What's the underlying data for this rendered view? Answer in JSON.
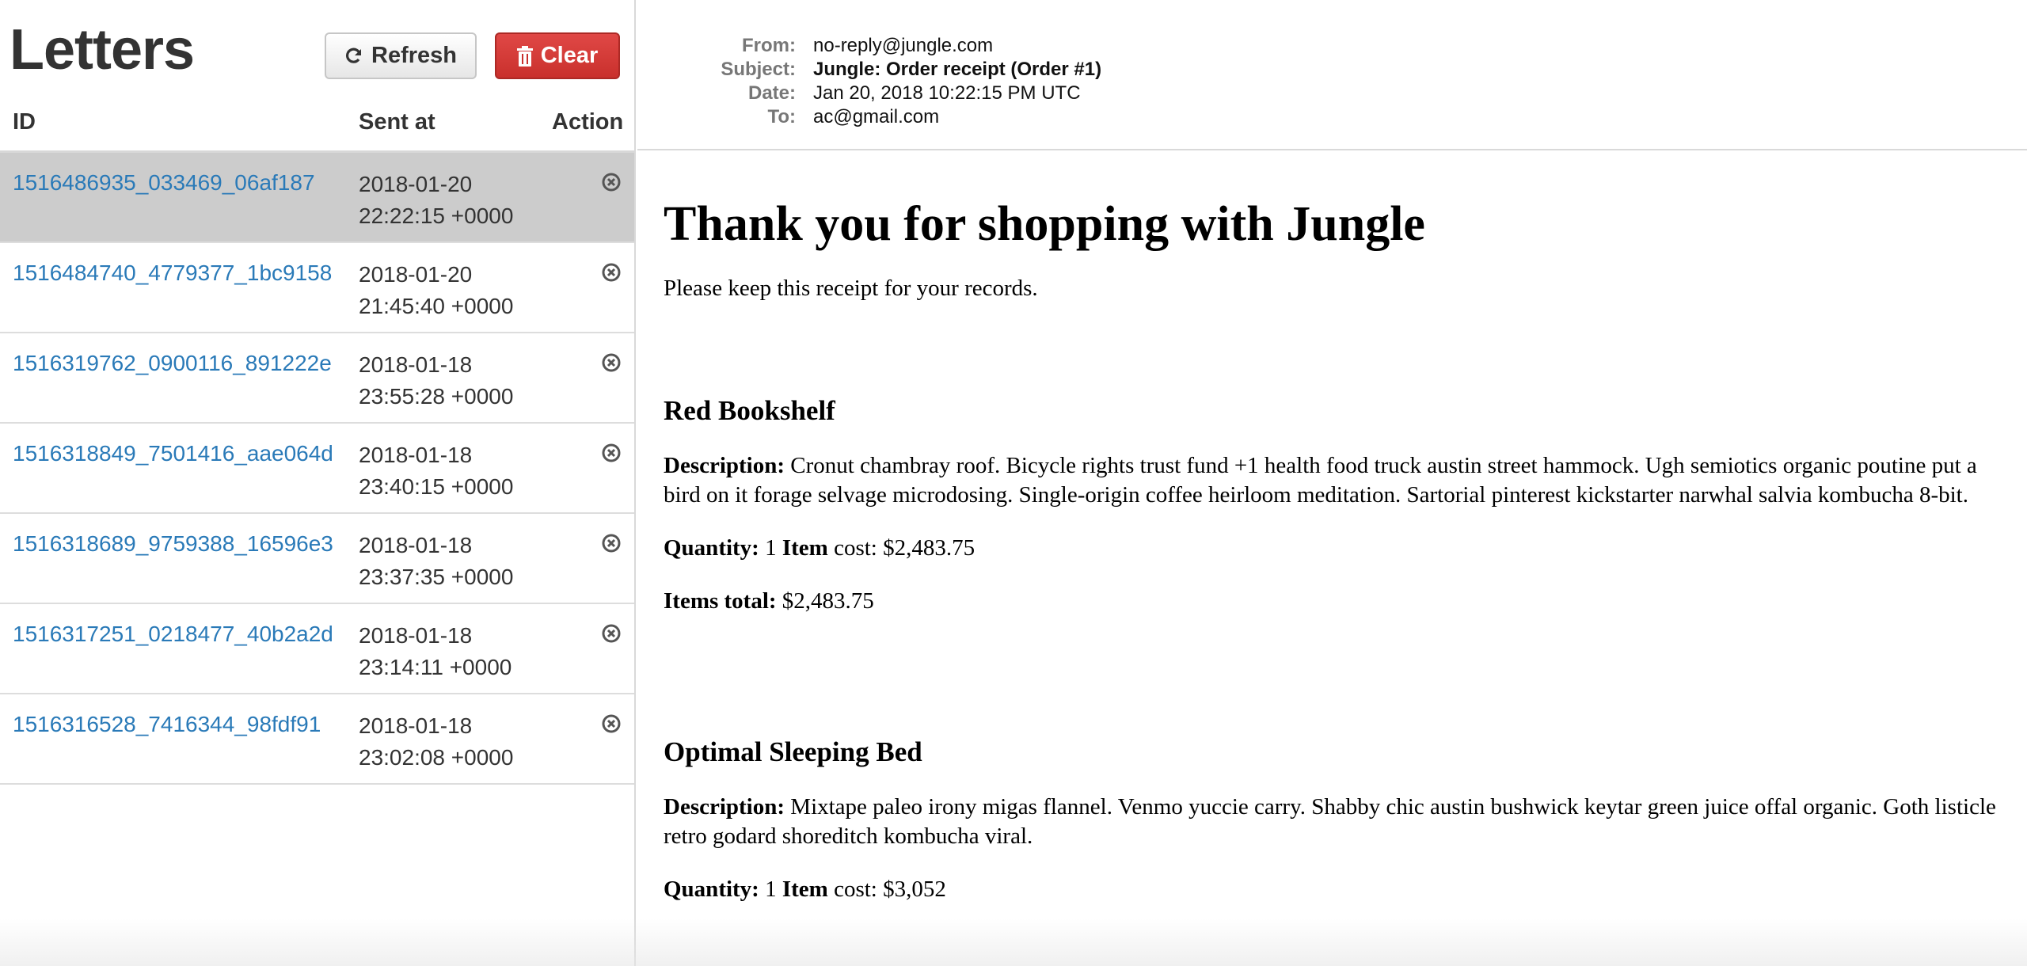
{
  "sidebar": {
    "title": "Letters",
    "refresh_label": "Refresh",
    "clear_label": "Clear",
    "columns": [
      "ID",
      "Sent at",
      "Action"
    ],
    "letters": [
      {
        "id": "1516486935_033469_06af187",
        "date": "2018-01-20",
        "time": "22:22:15 +0000",
        "selected": true
      },
      {
        "id": "1516484740_4779377_1bc9158",
        "date": "2018-01-20",
        "time": "21:45:40 +0000",
        "selected": false
      },
      {
        "id": "1516319762_0900116_891222e",
        "date": "2018-01-18",
        "time": "23:55:28 +0000",
        "selected": false
      },
      {
        "id": "1516318849_7501416_aae064d",
        "date": "2018-01-18",
        "time": "23:40:15 +0000",
        "selected": false
      },
      {
        "id": "1516318689_9759388_16596e3",
        "date": "2018-01-18",
        "time": "23:37:35 +0000",
        "selected": false
      },
      {
        "id": "1516317251_0218477_40b2a2d",
        "date": "2018-01-18",
        "time": "23:14:11 +0000",
        "selected": false
      },
      {
        "id": "1516316528_7416344_98fdf91",
        "date": "2018-01-18",
        "time": "23:02:08 +0000",
        "selected": false
      }
    ]
  },
  "email": {
    "headers": {
      "from_label": "From:",
      "from": "no-reply@jungle.com",
      "subject_label": "Subject:",
      "subject": "Jungle: Order receipt (Order #1)",
      "date_label": "Date:",
      "date": "Jan 20, 2018 10:22:15 PM UTC",
      "to_label": "To:",
      "to": "ac@gmail.com"
    },
    "heading": "Thank you for shopping with Jungle",
    "intro": "Please keep this receipt for your records.",
    "labels": {
      "description": "Description:",
      "quantity": "Quantity:",
      "item": "Item",
      "cost": "cost:",
      "items_total": "Items total:"
    },
    "products": [
      {
        "name": "Red Bookshelf",
        "description": "Cronut chambray roof. Bicycle rights trust fund +1 health food truck austin street hammock. Ugh semiotics organic poutine put a bird on it forage selvage microdosing. Single-origin coffee heirloom meditation. Sartorial pinterest kickstarter narwhal salvia kombucha 8-bit.",
        "quantity": "1",
        "item_cost": "$2,483.75",
        "items_total": "$2,483.75"
      },
      {
        "name": "Optimal Sleeping Bed",
        "description": "Mixtape paleo irony migas flannel. Venmo yuccie carry. Shabby chic austin bushwick keytar green juice offal organic. Goth listicle retro godard shoreditch kombucha viral.",
        "quantity": "1",
        "item_cost": "$3,052"
      }
    ]
  },
  "colors": {
    "link": "#2a7ab8",
    "selected_row": "#cccccc",
    "clear_button": "#d9534f"
  },
  "icons": {
    "refresh": "refresh-icon",
    "clear": "trash-icon",
    "row_action": "remove-circle-icon"
  }
}
